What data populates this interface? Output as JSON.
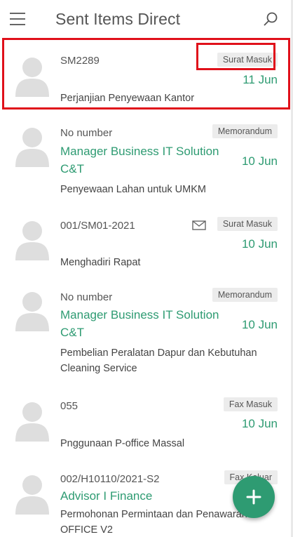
{
  "appbar": {
    "title": "Sent Items Direct",
    "menu_icon": "hamburger-menu-icon",
    "search_icon": "search-icon"
  },
  "colors": {
    "accent": "#2e9b72",
    "badge_bg": "#ececec",
    "highlight": "#e0101a"
  },
  "items": [
    {
      "ref": "SM2289",
      "type": "Surat Masuk",
      "sender": "",
      "date": "11 Jun",
      "subject": "Perjanjian Penyewaan Kantor",
      "has_mail_icon": false
    },
    {
      "ref": "No number",
      "type": "Memorandum",
      "sender": "Manager Business IT Solution C&T",
      "date": "10 Jun",
      "subject": "Penyewaan Lahan untuk UMKM",
      "has_mail_icon": false
    },
    {
      "ref": "001/SM01-2021",
      "type": "Surat Masuk",
      "sender": "",
      "date": "10 Jun",
      "subject": "Menghadiri Rapat",
      "has_mail_icon": true
    },
    {
      "ref": "No number",
      "type": "Memorandum",
      "sender": "Manager Business IT Solution C&T",
      "date": "10 Jun",
      "subject": "Pembelian Peralatan Dapur dan Kebutuhan Cleaning Service",
      "has_mail_icon": false
    },
    {
      "ref": "055",
      "type": "Fax Masuk",
      "sender": "",
      "date": "10 Jun",
      "subject": "Pnggunaan P-office Massal",
      "has_mail_icon": false
    },
    {
      "ref": "002/H10110/2021-S2",
      "type": "Fax Keluar",
      "sender": "Advisor I Finance",
      "date": "",
      "subject": "Permohonan Permintaan dan Penawaran P-OFFICE V2",
      "has_mail_icon": false
    }
  ],
  "fab": {
    "label": "+",
    "icon": "plus-icon"
  }
}
